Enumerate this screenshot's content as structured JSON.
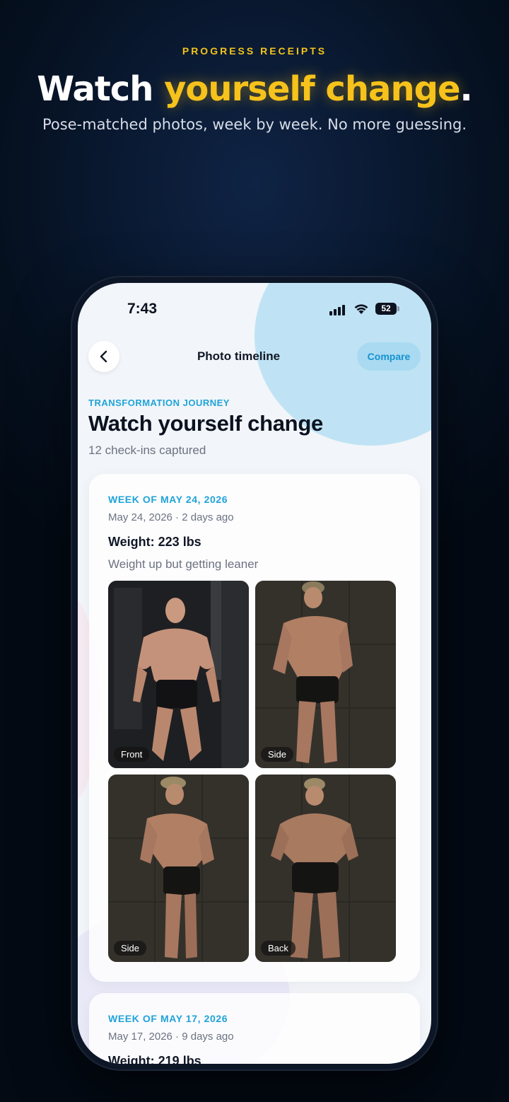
{
  "promo": {
    "eyebrow": "PROGRESS RECEIPTS",
    "headline_plain": "Watch ",
    "headline_accent": "yourself change",
    "headline_end": ".",
    "subline": "Pose-matched photos, week by week. No more guessing."
  },
  "status_bar": {
    "time": "7:43",
    "battery": "52"
  },
  "nav": {
    "title": "Photo timeline",
    "compare_label": "Compare"
  },
  "header": {
    "kicker": "TRANSFORMATION JOURNEY",
    "title": "Watch yourself change",
    "subtitle": "12 check-ins captured"
  },
  "checkins": [
    {
      "week_label": "WEEK OF MAY 24, 2026",
      "date": "May 24, 2026 · 2 days ago",
      "weight": "Weight: 223 lbs",
      "note": "Weight up but getting leaner",
      "photos": [
        {
          "pose": "Front"
        },
        {
          "pose": "Side"
        },
        {
          "pose": "Side"
        },
        {
          "pose": "Back"
        }
      ]
    },
    {
      "week_label": "WEEK OF MAY 17, 2026",
      "date": "May 17, 2026 · 9 days ago",
      "weight": "Weight: 219 lbs"
    }
  ],
  "colors": {
    "accent_yellow": "#f6c21b",
    "accent_blue": "#1fa3d8",
    "compare_bg": "#a9daf1"
  }
}
